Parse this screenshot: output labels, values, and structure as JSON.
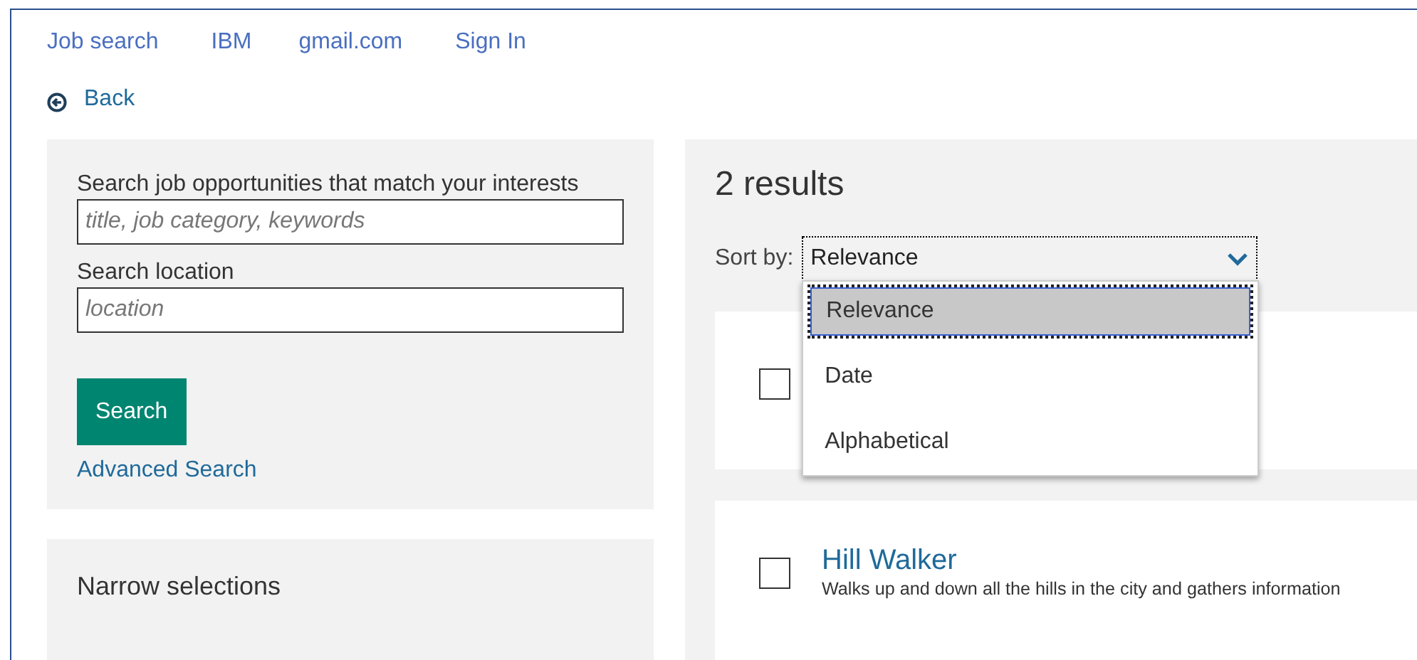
{
  "nav": [
    {
      "label": "Job search"
    },
    {
      "label": "IBM"
    },
    {
      "label": "gmail.com"
    },
    {
      "label": "Sign In"
    }
  ],
  "back": {
    "label": "Back"
  },
  "search": {
    "keyword_label": "Search job opportunities that match your interests",
    "keyword_placeholder": "title, job category, keywords",
    "location_label": "Search location",
    "location_placeholder": "location",
    "button": "Search",
    "advanced_link": "Advanced Search"
  },
  "narrow": {
    "title": "Narrow selections"
  },
  "results": {
    "count": "2 results",
    "sort_label": "Sort by:",
    "sort_value": "Relevance",
    "sort_open": true,
    "sort_options": [
      {
        "label": "Relevance",
        "selected": true
      },
      {
        "label": "Date",
        "selected": false
      },
      {
        "label": "Alphabetical",
        "selected": false
      }
    ],
    "jobs": [
      {
        "checked": false
      },
      {
        "checked": false,
        "title": "Hill Walker",
        "description": "Walks up and down all the hills in the city and gathers information"
      }
    ]
  }
}
